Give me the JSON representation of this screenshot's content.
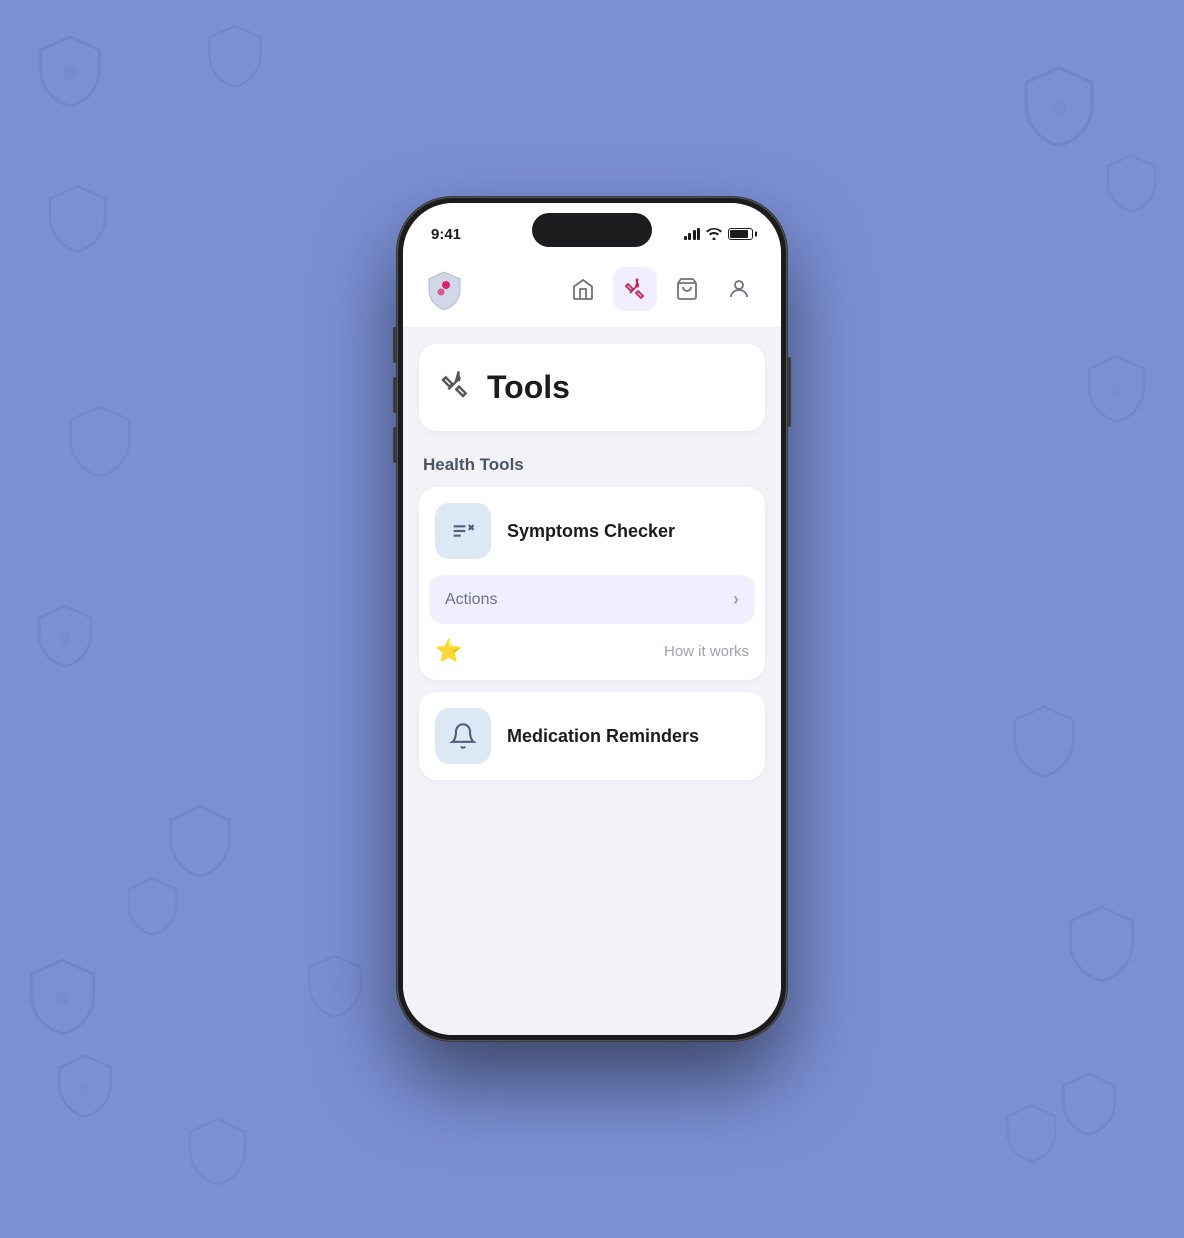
{
  "background": {
    "color": "#7b8fd4"
  },
  "status_bar": {
    "time": "9:41",
    "signal_label": "signal",
    "wifi_label": "wifi",
    "battery_label": "battery"
  },
  "nav": {
    "logo_alt": "App Logo",
    "icons": [
      {
        "name": "home",
        "label": "Home",
        "active": false
      },
      {
        "name": "tools",
        "label": "Tools",
        "active": true
      },
      {
        "name": "cart",
        "label": "Cart",
        "active": false
      },
      {
        "name": "profile",
        "label": "Profile",
        "active": false
      }
    ]
  },
  "tools_header": {
    "icon_label": "wrench-cross-icon",
    "title": "Tools"
  },
  "health_tools": {
    "section_label": "Health Tools",
    "tools": [
      {
        "name": "Symptoms Checker",
        "icon_label": "checklist-icon",
        "actions_label": "Actions",
        "how_it_works_label": "How it works"
      },
      {
        "name": "Medication Reminders",
        "icon_label": "bell-icon"
      }
    ]
  }
}
